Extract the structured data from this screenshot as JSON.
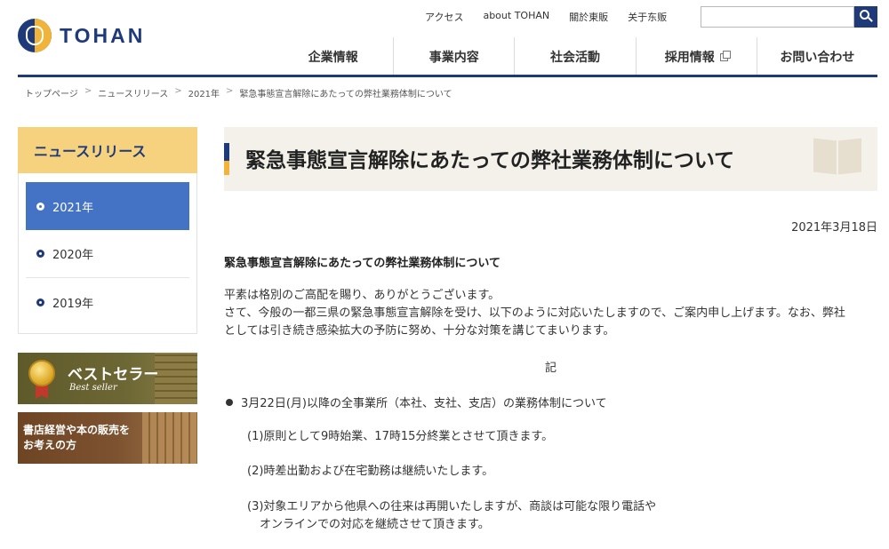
{
  "header": {
    "logo_text": "TOHAN",
    "util_links": [
      "アクセス",
      "about TOHAN",
      "關於東販",
      "关于东贩"
    ],
    "search_placeholder": "",
    "main_nav": [
      {
        "label": "企業情報"
      },
      {
        "label": "事業内容"
      },
      {
        "label": "社会活動"
      },
      {
        "label": "採用情報",
        "external": true
      },
      {
        "label": "お問い合わせ"
      }
    ]
  },
  "breadcrumb": [
    "トップページ",
    "ニュースリリース",
    "2021年",
    "緊急事態宣言解除にあたっての弊社業務体制について"
  ],
  "sidebar": {
    "heading": "ニュースリリース",
    "items": [
      {
        "label": "2021年",
        "active": true
      },
      {
        "label": "2020年",
        "active": false
      },
      {
        "label": "2019年",
        "active": false
      }
    ],
    "banner_bestseller": {
      "title": "ベストセラー",
      "subtitle": "Best seller"
    },
    "banner_store": {
      "line1": "書店経営や本の販売を",
      "line2": "お考えの方"
    }
  },
  "article": {
    "title": "緊急事態宣言解除にあたっての弊社業務体制について",
    "date": "2021年3月18日",
    "subtitle": "緊急事態宣言解除にあたっての弊社業務体制について",
    "intro_lines": [
      "平素は格別のご高配を賜り、ありがとうございます。",
      "さて、今般の一都三県の緊急事態宣言解除を受け、以下のように対応いたしますので、ご案内申し上げます。なお、弊社",
      "としては引き続き感染拡大の予防に努め、十分な対策を講じてまいります。"
    ],
    "ki": "記",
    "section_heading": "3月22日(月)以降の全事業所（本社、支社、支店）の業務体制について",
    "rules": [
      "(1)原則として9時始業、17時15分終業とさせて頂きます。",
      "(2)時差出勤および在宅勤務は継続いたします。",
      "(3)対象エリアから他県への往来は再開いたしますが、商談は可能な限り電話や",
      "オンラインでの対応を継続させて頂きます。"
    ]
  },
  "colors": {
    "brand_navy": "#1f3a78",
    "brand_gold": "#f0b43a",
    "sidebar_active": "#4472c4",
    "sidebar_heading_bg": "#f6d27e"
  }
}
